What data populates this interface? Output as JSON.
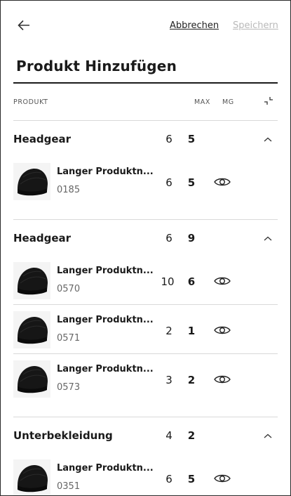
{
  "header": {
    "cancel_label": "Abbrechen",
    "save_label": "Speichern",
    "title": "Produkt Hinzufügen"
  },
  "columns": {
    "product": "PRODUKT",
    "max": "MAX",
    "qty": "MG"
  },
  "colors": {
    "text": "#1a1a1a",
    "muted": "#666666",
    "disabled": "#b9b9b9",
    "divider": "#d9d9d9"
  },
  "groups": [
    {
      "name": "Headgear",
      "max": "6",
      "qty": "5",
      "items": [
        {
          "name": "Langer Produktn...",
          "number": "0185",
          "max": "6",
          "qty": "5"
        }
      ]
    },
    {
      "name": "Headgear",
      "max": "6",
      "qty": "9",
      "items": [
        {
          "name": "Langer Produktn...",
          "number": "0570",
          "max": "10",
          "qty": "6"
        },
        {
          "name": "Langer Produktn...",
          "number": "0571",
          "max": "2",
          "qty": "1"
        },
        {
          "name": "Langer Produktn...",
          "number": "0573",
          "max": "3",
          "qty": "2"
        }
      ]
    },
    {
      "name": "Unterbekleidung",
      "max": "4",
      "qty": "2",
      "items": [
        {
          "name": "Langer Produktn...",
          "number": "0351",
          "max": "6",
          "qty": "5"
        }
      ]
    }
  ],
  "icons": {
    "back": "arrow-left-icon",
    "collapse_all": "collapse-icon",
    "group_toggle": "chevron-up-icon",
    "view": "eye-icon",
    "product_image": "beanie-hat-image"
  }
}
